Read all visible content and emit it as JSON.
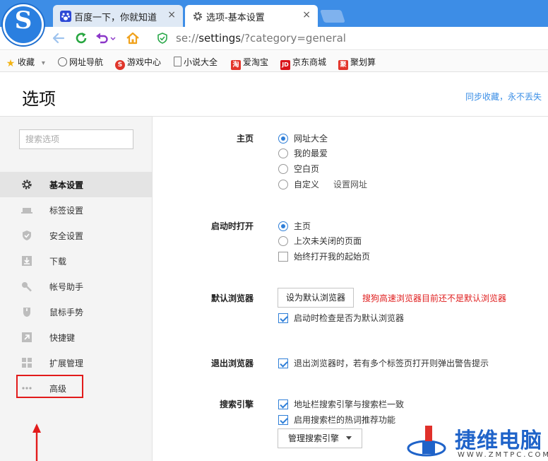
{
  "tabs": [
    {
      "title": "百度一下，你就知道",
      "close": "×"
    },
    {
      "title": "选项-基本设置",
      "close": "×"
    }
  ],
  "address": {
    "scheme": "se://",
    "host": "settings",
    "rest": "/?category=general"
  },
  "bookmarks": [
    {
      "label": "收藏",
      "caret": "▾"
    },
    {
      "label": "网址导航"
    },
    {
      "label": "游戏中心"
    },
    {
      "label": "小说大全"
    },
    {
      "label": "爱淘宝",
      "badge": "淘"
    },
    {
      "label": "京东商城",
      "badge": "JD"
    },
    {
      "label": "聚划算",
      "badge": "聚"
    }
  ],
  "logo_letter": "S",
  "page_title": "选项",
  "sync_link": "同步收藏，永不丢失",
  "sidebar": {
    "search_placeholder": "搜索选项",
    "items": [
      {
        "label": "基本设置",
        "icon": "gear-icon"
      },
      {
        "label": "标签设置",
        "icon": "tab-icon"
      },
      {
        "label": "安全设置",
        "icon": "shield-icon"
      },
      {
        "label": "下载",
        "icon": "download-icon"
      },
      {
        "label": "帐号助手",
        "icon": "key-icon"
      },
      {
        "label": "鼠标手势",
        "icon": "mouse-icon"
      },
      {
        "label": "快捷键",
        "icon": "shortcut-icon"
      },
      {
        "label": "扩展管理",
        "icon": "extensions-icon"
      },
      {
        "label": "高级",
        "icon": "more-icon"
      }
    ]
  },
  "homepage": {
    "label": "主页",
    "options": [
      "网址大全",
      "我的最爱",
      "空白页",
      "自定义"
    ],
    "selected": 0,
    "set_url": "设置网址"
  },
  "startup": {
    "label": "启动时打开",
    "options": [
      "主页",
      "上次未关闭的页面"
    ],
    "selected": 0,
    "always_open": "始终打开我的起始页"
  },
  "default_browser": {
    "label": "默认浏览器",
    "button": "设为默认浏览器",
    "warning": "搜狗高速浏览器目前还不是默认浏览器",
    "check_on_start": "启动时检查是否为默认浏览器"
  },
  "exit_browser": {
    "label": "退出浏览器",
    "option": "退出浏览器时，若有多个标签页打开则弹出警告提示"
  },
  "search_engine": {
    "label": "搜索引擎",
    "option1": "地址栏搜索引擎与搜索栏一致",
    "option2": "启用搜索栏的热词推荐功能",
    "manage_button": "管理搜索引擎"
  },
  "watermark": {
    "title": "捷维电脑",
    "sub": "WWW.ZMTPC.COM"
  },
  "colors": {
    "accent": "#2f7fd8",
    "warning": "#e01f1f",
    "annotation": "#e21b1b",
    "tabbar": "#3d8de6"
  }
}
